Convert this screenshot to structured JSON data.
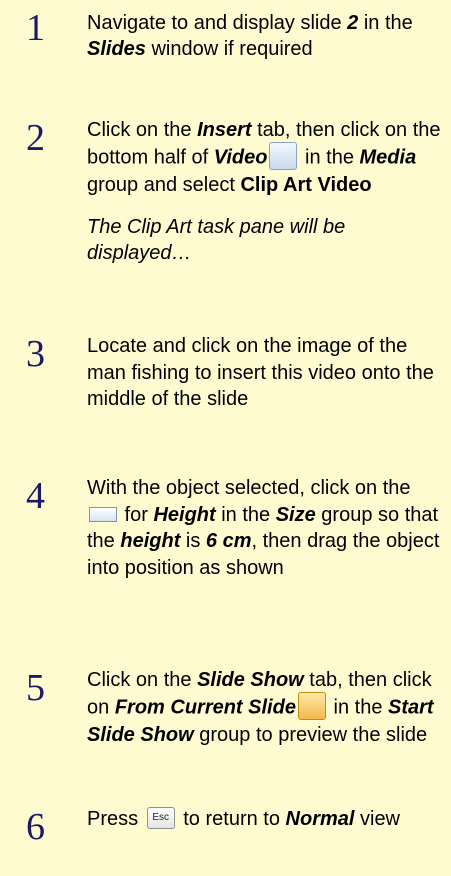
{
  "steps": [
    {
      "number": "1",
      "text": {
        "a": "Navigate to and display slide ",
        "slide_num": "2",
        "b": " in the ",
        "slides": "Slides",
        "c": " window if required"
      }
    },
    {
      "number": "2",
      "text": {
        "a": "Click on the ",
        "insert": "Insert",
        "b": " tab, then click on the bottom half of ",
        "video": "Video",
        "c": " in the ",
        "media": "Media",
        "d": " group and select ",
        "clipart": "Clip Art Video"
      },
      "note": "The Clip Art task pane will be displayed…"
    },
    {
      "number": "3",
      "text": {
        "a": "Locate and click on the image of the man fishing to insert this video onto the middle of the slide"
      }
    },
    {
      "number": "4",
      "text": {
        "a": "With the object selected, click on the ",
        "b": " for ",
        "height": "Height",
        "c": " in the ",
        "size": "Size",
        "d": " group so that the ",
        "height2": "height",
        "e": " is ",
        "cm": "6 cm",
        "f": ", then drag the object into position as shown"
      }
    },
    {
      "number": "5",
      "text": {
        "a": "Click on the ",
        "slideshow": "Slide Show",
        "b": " tab, then click on ",
        "fromcurrent": "From Current Slide",
        "c": " in the ",
        "startslideshow": "Start Slide Show",
        "d": " group to preview the slide"
      }
    },
    {
      "number": "6",
      "text": {
        "a": "Press ",
        "b": " to return to ",
        "normal": "Normal",
        "c": " view"
      }
    }
  ],
  "icons": {
    "video": "video-icon",
    "spinner": "spinner-up-icon",
    "slideshow": "from-current-slide-icon",
    "esc": "esc-key-icon",
    "esc_label": "Esc"
  }
}
